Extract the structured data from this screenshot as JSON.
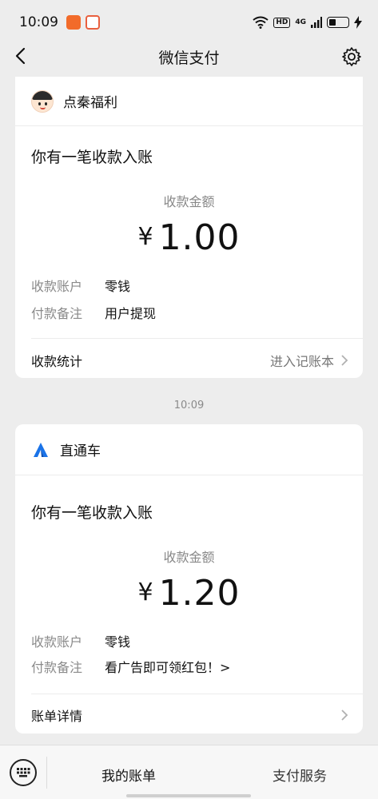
{
  "status_bar": {
    "time": "10:09",
    "hd_badge": "HD",
    "net_label": "4G"
  },
  "nav": {
    "title": "微信支付"
  },
  "cards": [
    {
      "sender": "点秦福利",
      "headline": "你有一笔收款入账",
      "amount_label": "收款金额",
      "currency": "¥",
      "amount": "1.00",
      "rows": [
        {
          "key": "收款账户",
          "value": "零钱"
        },
        {
          "key": "付款备注",
          "value": "用户提现"
        }
      ],
      "footer_left": "收款统计",
      "footer_right": "进入记账本"
    },
    {
      "sender": "直通车",
      "headline": "你有一笔收款入账",
      "amount_label": "收款金额",
      "currency": "¥",
      "amount": "1.20",
      "rows": [
        {
          "key": "收款账户",
          "value": "零钱"
        },
        {
          "key": "付款备注",
          "value": "看广告即可领红包！>"
        }
      ],
      "footer_left": "账单详情",
      "footer_right": ""
    }
  ],
  "timestamp": "10:09",
  "bottom_bar": {
    "item1": "我的账单",
    "item2": "支付服务"
  },
  "colors": {
    "background": "#ededed",
    "card": "#ffffff",
    "muted_text": "#8a8a8a",
    "brand_blue": "#1a73e8"
  }
}
